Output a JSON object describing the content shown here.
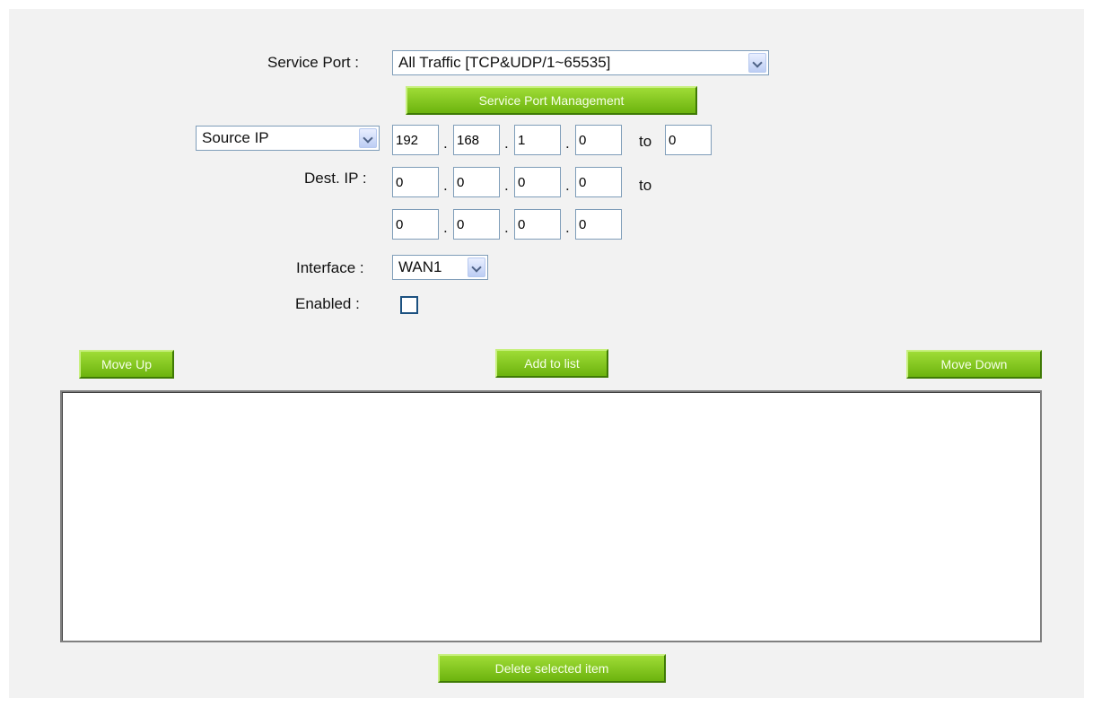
{
  "service_port": {
    "label": "Service Port :",
    "selected": "All Traffic [TCP&UDP/1~65535]",
    "management_button": "Service Port Management"
  },
  "source": {
    "type_selected": "Source IP",
    "ip": [
      "192",
      "168",
      "1",
      "0"
    ],
    "to_label": "to",
    "to_value": "0"
  },
  "dest": {
    "label": "Dest. IP :",
    "ip_from": [
      "0",
      "0",
      "0",
      "0"
    ],
    "to_label": "to",
    "ip_to": [
      "0",
      "0",
      "0",
      "0"
    ]
  },
  "interface": {
    "label": "Interface :",
    "selected": "WAN1"
  },
  "enabled": {
    "label": "Enabled :",
    "checked": false
  },
  "buttons": {
    "move_up": "Move Up",
    "add_to_list": "Add to list",
    "move_down": "Move Down",
    "delete_selected": "Delete selected item"
  },
  "rule_list": []
}
